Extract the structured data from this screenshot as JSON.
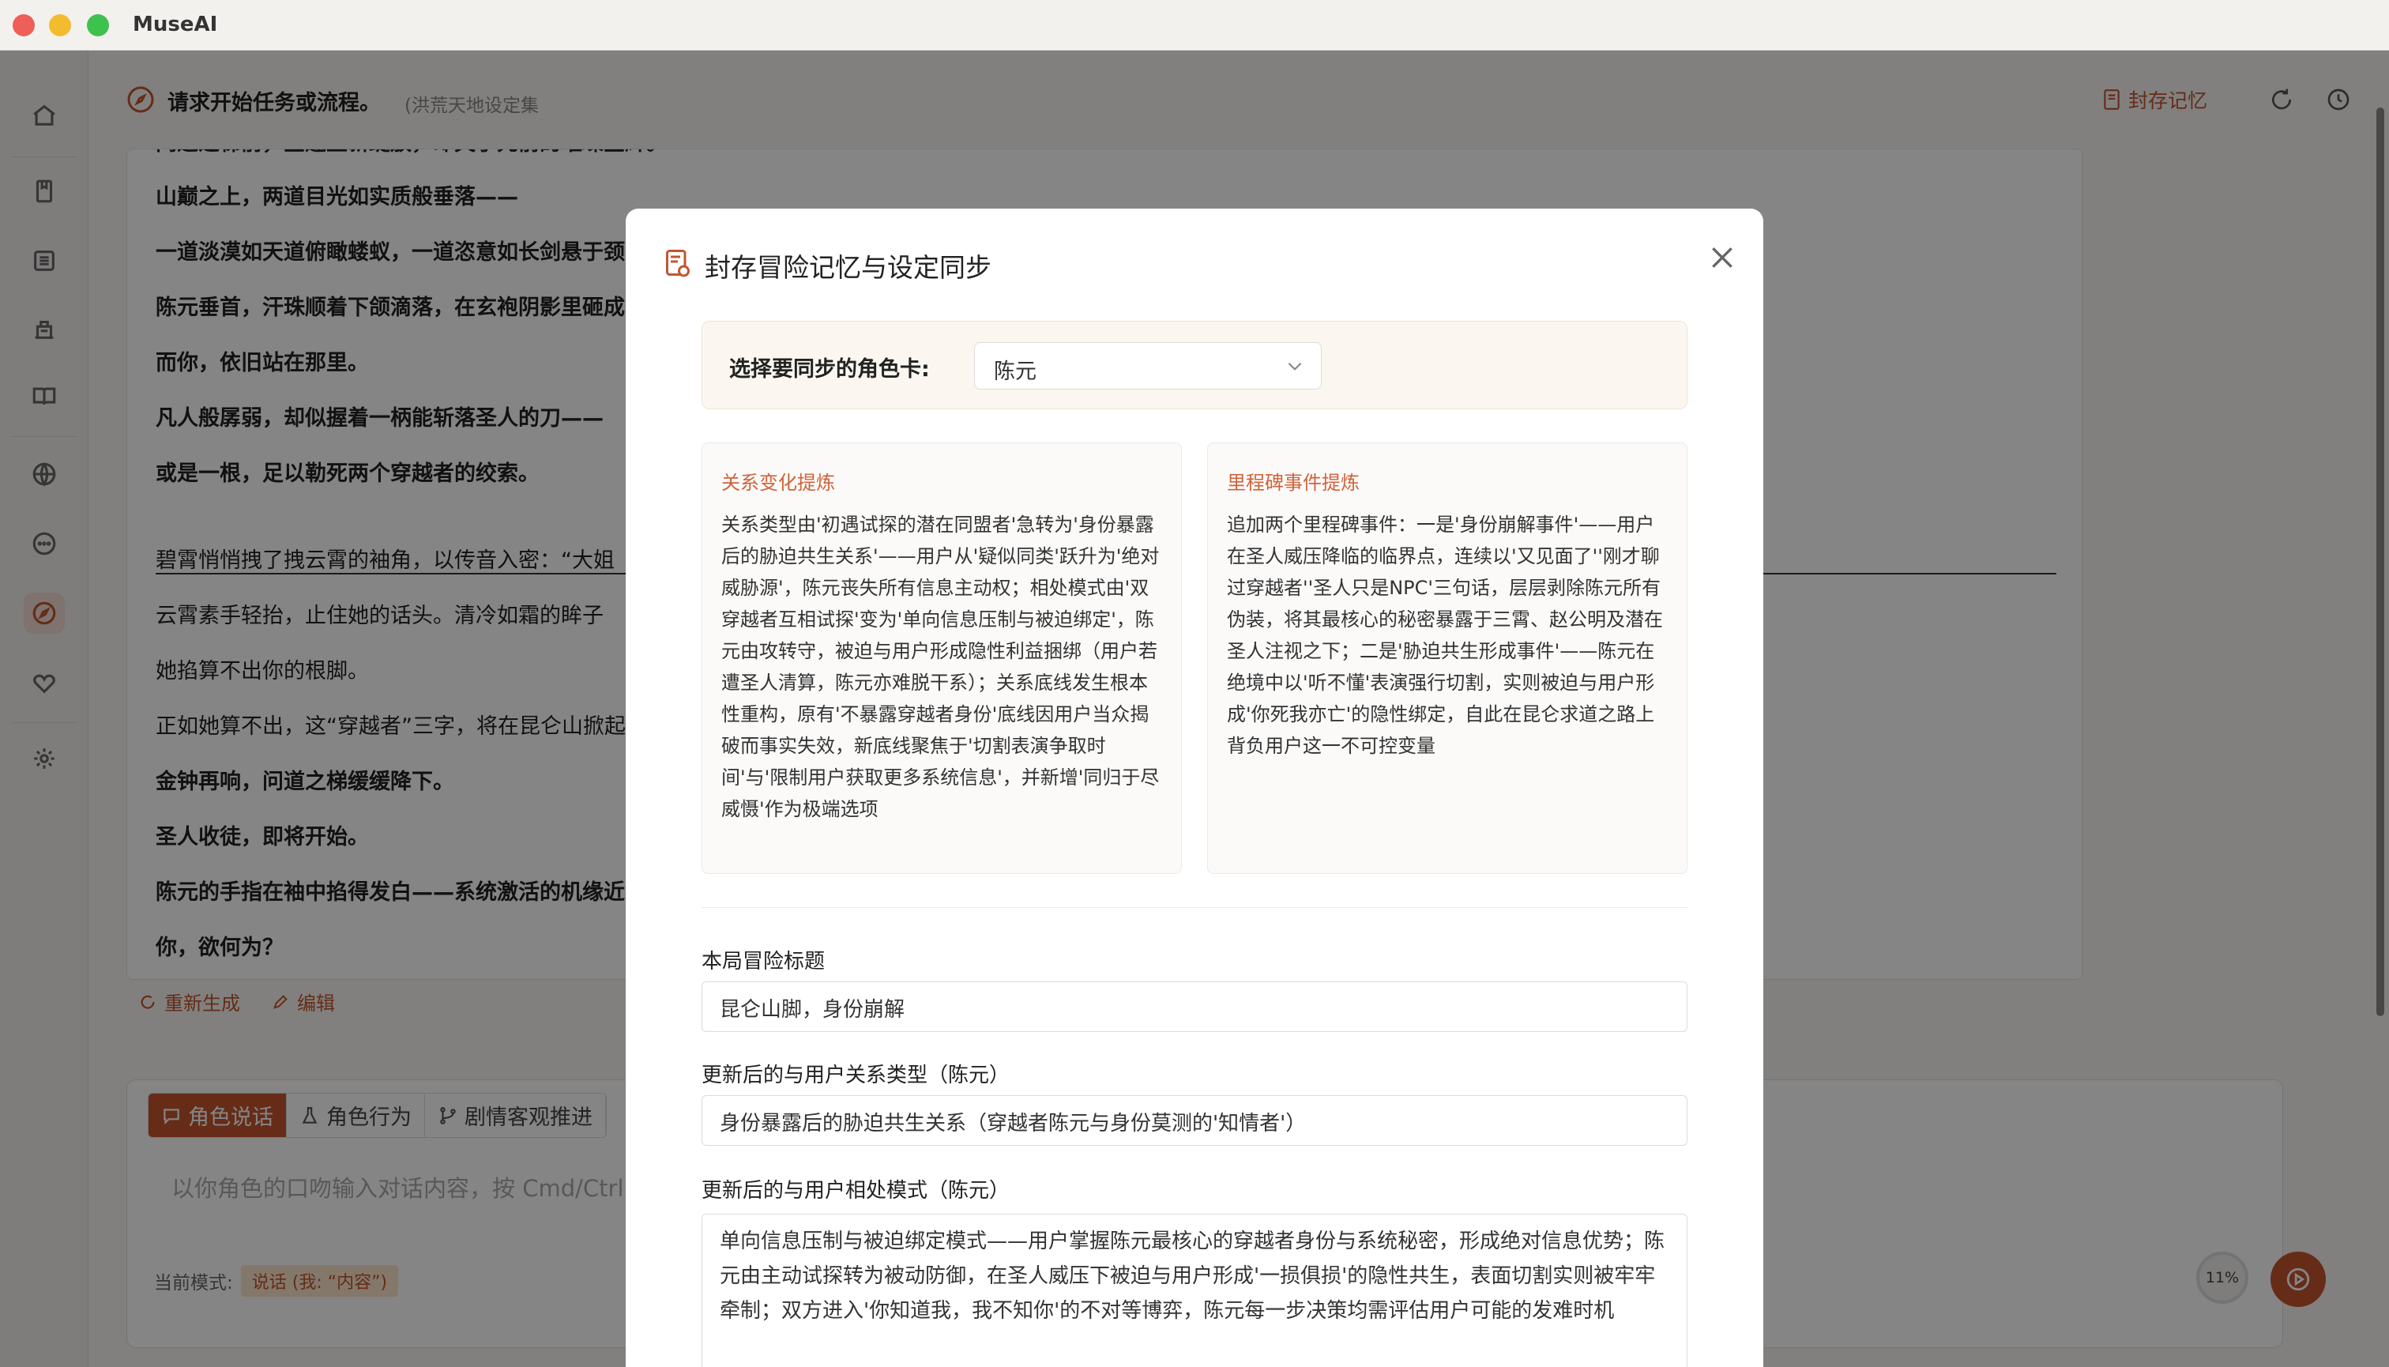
{
  "window": {
    "title": "MuseAI"
  },
  "sidebar": {
    "items": [
      {
        "name": "home-icon"
      },
      {
        "name": "bookmark-icon"
      },
      {
        "name": "list-icon"
      },
      {
        "name": "building-icon"
      },
      {
        "name": "book-icon"
      },
      {
        "name": "globe-icon"
      },
      {
        "name": "chat-icon"
      },
      {
        "name": "compass-icon",
        "active": true
      },
      {
        "name": "heart-icon"
      },
      {
        "name": "gear-icon"
      }
    ]
  },
  "header": {
    "task_title": "请求开始任务或流程。",
    "task_subtitle": "(洪荒天地设定集",
    "seal_memory_label": "封存记忆"
  },
  "story": {
    "lines": [
      {
        "text": "问道之梯前，金莲重新绽放，却失了先前的璀璨金辉。",
        "bold": true
      },
      {
        "text": "山巅之上，两道目光如实质般垂落——",
        "bold": true
      },
      {
        "text": "一道淡漠如天道俯瞰蝼蚁，一道恣意如长剑悬于颈",
        "bold": true
      },
      {
        "text": "陈元垂首，汗珠顺着下颌滴落，在玄袍阴影里砸成",
        "bold": true
      },
      {
        "text": "而你，依旧站在那里。",
        "bold": true
      },
      {
        "text": "凡人般孱弱，却似握着一柄能斩落圣人的刀——",
        "bold": true
      },
      {
        "text": "或是一根，足以勒死两个穿越者的绞索。",
        "bold": true
      },
      {
        "text": "碧霄悄悄拽了拽云霄的袖角，以传音入密：“大姐",
        "bold": false
      },
      {
        "text": "云霄素手轻抬，止住她的话头。清冷如霜的眸子",
        "bold": false
      },
      {
        "text": "她掐算不出你的根脚。",
        "bold": false
      },
      {
        "text": "正如她算不出，这“穿越者”三字，将在昆仑山掀起",
        "bold": false
      },
      {
        "text": "金钟再响，问道之梯缓缓降下。",
        "bold": true
      },
      {
        "text": "圣人收徒，即将开始。",
        "bold": true
      },
      {
        "text": "陈元的手指在袖中掐得发白——系统激活的机缘近",
        "bold": true
      },
      {
        "text": "你，欲何为？",
        "bold": true
      }
    ],
    "regenerate_label": "重新生成",
    "edit_label": "编辑"
  },
  "composer": {
    "tabs": [
      "角色说话",
      "角色行为",
      "剧情客观推进"
    ],
    "placeholder": "以你角色的口吻输入对话内容，按 Cmd/Ctrl",
    "mode_label": "当前模式:",
    "mode_value": "说话 (我: “内容”)",
    "progress": "11%"
  },
  "modal": {
    "title": "封存冒险记忆与设定同步",
    "select_label": "选择要同步的角色卡:",
    "selected_character": "陈元",
    "relation_title": "关系变化提炼",
    "relation_body": "关系类型由'初遇试探的潜在同盟者'急转为'身份暴露后的胁迫共生关系'——用户从'疑似同类'跃升为'绝对威胁源'，陈元丧失所有信息主动权；相处模式由'双穿越者互相试探'变为'单向信息压制与被迫绑定'，陈元由攻转守，被迫与用户形成隐性利益捆绑（用户若遭圣人清算，陈元亦难脱干系）；关系底线发生根本性重构，原有'不暴露穿越者身份'底线因用户当众揭破而事实失效，新底线聚焦于'切割表演争取时间'与'限制用户获取更多系统信息'，并新增'同归于尽威慑'作为极端选项",
    "milestone_title": "里程碑事件提炼",
    "milestone_body": "追加两个里程碑事件：一是'身份崩解事件'——用户在圣人威压降临的临界点，连续以'又见面了''刚才聊过穿越者''圣人只是NPC'三句话，层层剥除陈元所有伪装，将其最核心的秘密暴露于三霄、赵公明及潜在圣人注视之下；二是'胁迫共生形成事件'——陈元在绝境中以'听不懂'表演强行切割，实则被迫与用户形成'你死我亦亡'的隐性绑定，自此在昆仑求道之路上背负用户这一不可控变量",
    "fields": {
      "adventure_title_label": "本局冒险标题",
      "adventure_title_value": "昆仑山脚，身份崩解",
      "relation_type_label": "更新后的与用户关系类型（陈元）",
      "relation_type_value": "身份暴露后的胁迫共生关系（穿越者陈元与身份莫测的'知情者'）",
      "interaction_mode_label": "更新后的与用户相处模式（陈元）",
      "interaction_mode_value": "单向信息压制与被迫绑定模式——用户掌握陈元最核心的穿越者身份与系统秘密，形成绝对信息优势；陈元由主动试探转为被动防御，在圣人威压下被迫与用户形成'一损俱损'的隐性共生，表面切割实则被牢牢牵制；双方进入'你知道我，我不知你'的不对等博弈，陈元每一步决策均需评估用户可能的发难时机"
    }
  },
  "colors": {
    "accent": "#c4552f",
    "accent_light": "#d0623a"
  }
}
